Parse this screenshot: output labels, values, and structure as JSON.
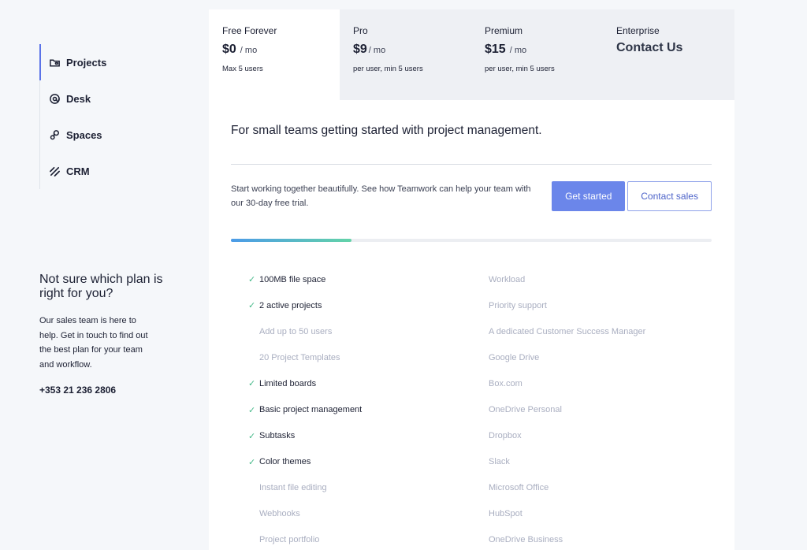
{
  "sidebar": {
    "items": [
      {
        "label": "Projects",
        "icon": "folder-icon",
        "active": true
      },
      {
        "label": "Desk",
        "icon": "at-sign-icon",
        "active": false
      },
      {
        "label": "Spaces",
        "icon": "spaces-icon",
        "active": false
      },
      {
        "label": "CRM",
        "icon": "crm-stripes-icon",
        "active": false
      }
    ],
    "help": {
      "title": "Not sure which plan is right for you?",
      "body": "Our sales team is here to help. Get in touch to find out the best plan for your team and workflow.",
      "phone": "+353 21 236 2806"
    }
  },
  "plans": [
    {
      "name": "Free Forever",
      "price": "$0",
      "per": "/ mo",
      "note": "Max 5 users"
    },
    {
      "name": "Pro",
      "price": "$9",
      "per": "/ mo",
      "note": "per user, min 5 users"
    },
    {
      "name": "Premium",
      "price": "$15",
      "per": "/ mo",
      "note": "per user, min 5 users"
    },
    {
      "name": "Enterprise",
      "cta": "Contact Us"
    }
  ],
  "panel": {
    "tagline": "For small teams getting started with project management.",
    "cta_text": "Start working together beautifully. See how Teamwork can help your team with our 30-day free trial.",
    "primary_button": "Get started",
    "secondary_button": "Contact sales",
    "progress_fraction": 0.25
  },
  "features": {
    "left": [
      {
        "label": "100MB file space",
        "included": true
      },
      {
        "label": "2 active projects",
        "included": true
      },
      {
        "label": "Add up to 50 users",
        "included": false
      },
      {
        "label": "20 Project Templates",
        "included": false
      },
      {
        "label": "Limited boards",
        "included": true
      },
      {
        "label": "Basic project management",
        "included": true
      },
      {
        "label": "Subtasks",
        "included": true
      },
      {
        "label": "Color themes",
        "included": true
      },
      {
        "label": "Instant file editing",
        "included": false
      },
      {
        "label": "Webhooks",
        "included": false
      },
      {
        "label": "Project portfolio",
        "included": false
      }
    ],
    "right": [
      {
        "label": "Workload",
        "included": false
      },
      {
        "label": "Priority support",
        "included": false
      },
      {
        "label": "A dedicated Customer Success Manager",
        "included": false
      },
      {
        "label": "Google Drive",
        "included": false
      },
      {
        "label": "Box.com",
        "included": false
      },
      {
        "label": "OneDrive Personal",
        "included": false
      },
      {
        "label": "Dropbox",
        "included": false
      },
      {
        "label": "Slack",
        "included": false
      },
      {
        "label": "Microsoft Office",
        "included": false
      },
      {
        "label": "HubSpot",
        "included": false
      },
      {
        "label": "OneDrive Business",
        "included": false
      }
    ],
    "check_glyph": "✓",
    "check_color": "#46b989"
  },
  "colors": {
    "accent": "#6b86ea",
    "text": "#1c2033",
    "muted": "#a9aec0"
  }
}
